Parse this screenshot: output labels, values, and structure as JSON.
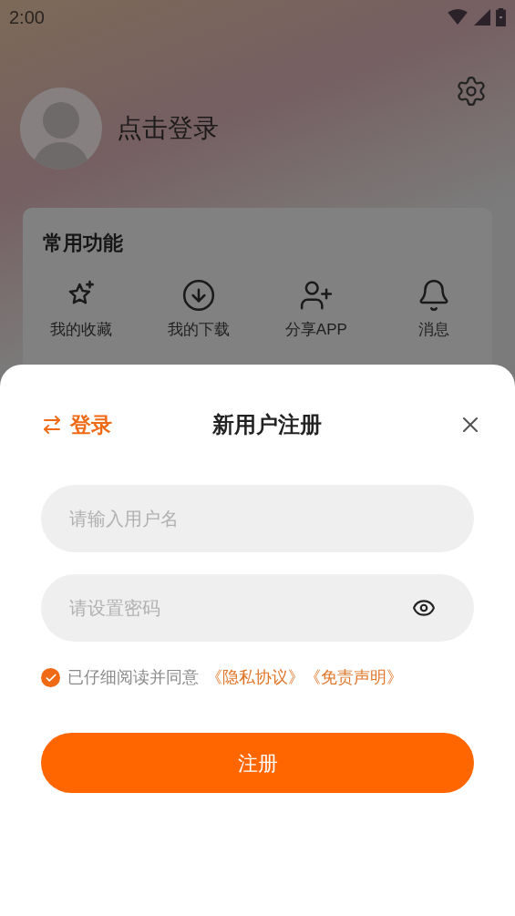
{
  "status_bar": {
    "time": "2:00"
  },
  "profile": {
    "login_text": "点击登录"
  },
  "features": {
    "title": "常用功能",
    "items": [
      {
        "kind": "favorites",
        "label": "我的收藏"
      },
      {
        "kind": "downloads",
        "label": "我的下载"
      },
      {
        "kind": "share",
        "label": "分享APP"
      },
      {
        "kind": "messages",
        "label": "消息"
      }
    ]
  },
  "sheet": {
    "switch_link": "登录",
    "title": "新用户注册",
    "username": {
      "placeholder": "请输入用户名"
    },
    "password": {
      "placeholder": "请设置密码"
    },
    "agreement": {
      "checked": true,
      "text": "已仔细阅读并同意",
      "links": [
        "《隐私协议》",
        "《免责声明》"
      ]
    },
    "submit": "注册"
  }
}
